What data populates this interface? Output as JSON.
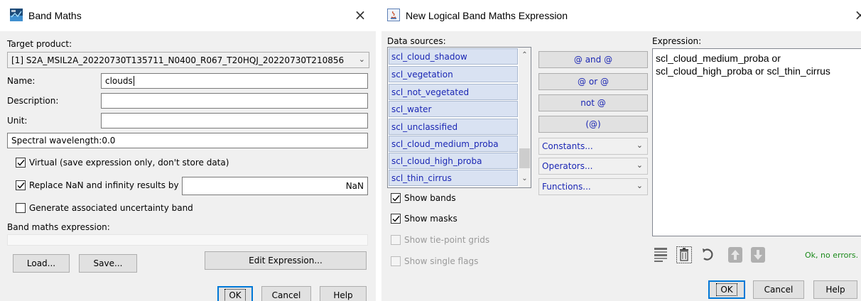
{
  "band_maths": {
    "title": "Band Maths",
    "close_glyph": "×",
    "icon": "snap-app-icon",
    "target_product_label": "Target product:",
    "target_product_value": "[1] S2A_MSIL2A_20220730T135711_N0400_R067_T20HQJ_20220730T210856",
    "name_label": "Name:",
    "name_value": "clouds",
    "description_label": "Description:",
    "description_value": "",
    "unit_label": "Unit:",
    "unit_value": "",
    "wavelength_label": "Spectral wavelength:",
    "wavelength_value": "0.0",
    "virtual_label": "Virtual (save expression only, don't store data)",
    "virtual_checked": true,
    "replace_nan_label": "Replace NaN and infinity results by",
    "replace_nan_checked": true,
    "replace_nan_value": "NaN",
    "uncertainty_label": "Generate associated uncertainty band",
    "uncertainty_checked": false,
    "expression_label": "Band maths expression:",
    "load_label": "Load...",
    "save_label": "Save...",
    "edit_expression_label": "Edit Expression...",
    "ok_label": "OK",
    "cancel_label": "Cancel",
    "help_label": "Help"
  },
  "logical_expr": {
    "title": "New Logical Band Maths Expression",
    "close_glyph": "×",
    "icon": "java-app-icon",
    "data_sources_label": "Data sources:",
    "data_sources": [
      "scl_cloud_shadow",
      "scl_vegetation",
      "scl_not_vegetated",
      "scl_water",
      "scl_unclassified",
      "scl_cloud_medium_proba",
      "scl_cloud_high_proba",
      "scl_thin_cirrus"
    ],
    "operator_buttons": [
      "@ and @",
      "@ or @",
      "not @",
      "(@)"
    ],
    "dropdowns": [
      "Constants...",
      "Operators...",
      "Functions..."
    ],
    "show_bands_label": "Show bands",
    "show_bands_checked": true,
    "show_masks_label": "Show masks",
    "show_masks_checked": true,
    "show_tiepoint_label": "Show tie-point grids",
    "show_tiepoint_enabled": false,
    "show_flags_label": "Show single flags",
    "show_flags_enabled": false,
    "expression_label": "Expression:",
    "expression_text": "scl_cloud_medium_proba or\nscl_cloud_high_proba or scl_thin_cirrus",
    "toolbar_icons": [
      "history-icon",
      "delete-icon",
      "undo-icon",
      "move-up-icon",
      "move-down-icon"
    ],
    "status_text": "Ok, no errors.",
    "status_color": "#1a8a1a",
    "ok_label": "OK",
    "cancel_label": "Cancel",
    "help_label": "Help"
  },
  "colors": {
    "list_item_bg": "#d9e2f2",
    "list_item_text": "#1a26b4",
    "dialog_bg": "#f0f0f0",
    "default_button_border": "#0078d7"
  }
}
